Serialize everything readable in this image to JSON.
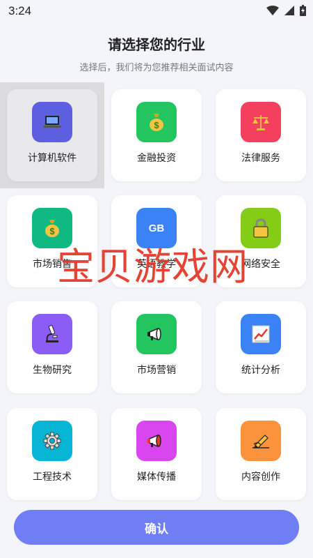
{
  "status": {
    "time": "3:24"
  },
  "header": {
    "title": "请选择您的行业",
    "subtitle": "选择后，我们将为您推荐相关面试内容"
  },
  "categories": [
    {
      "label": "计算机软件",
      "icon": "laptop-icon",
      "color": "#5b5fe0",
      "selected": true
    },
    {
      "label": "金融投资",
      "icon": "money-bag-icon",
      "color": "#22c55e"
    },
    {
      "label": "法律服务",
      "icon": "scales-icon",
      "color": "#f43f5e"
    },
    {
      "label": "市场销售",
      "icon": "money-bag-icon",
      "color": "#10b981"
    },
    {
      "label": "英语教学",
      "icon": "gb-icon",
      "icon_text": "GB",
      "color": "#3b82f6"
    },
    {
      "label": "网络安全",
      "icon": "lock-icon",
      "color": "#84cc16"
    },
    {
      "label": "生物研究",
      "icon": "microscope-icon",
      "color": "#8b5cf6"
    },
    {
      "label": "市场营销",
      "icon": "megaphone-icon",
      "color": "#22c55e"
    },
    {
      "label": "统计分析",
      "icon": "chart-icon",
      "color": "#3b82f6"
    },
    {
      "label": "工程技术",
      "icon": "gear-icon",
      "color": "#06b6d4"
    },
    {
      "label": "媒体传播",
      "icon": "megaphone-icon",
      "color": "#d946ef"
    },
    {
      "label": "内容创作",
      "icon": "pencil-icon",
      "color": "#fb923c"
    }
  ],
  "watermark": "宝贝游戏网",
  "confirm_label": "确认"
}
